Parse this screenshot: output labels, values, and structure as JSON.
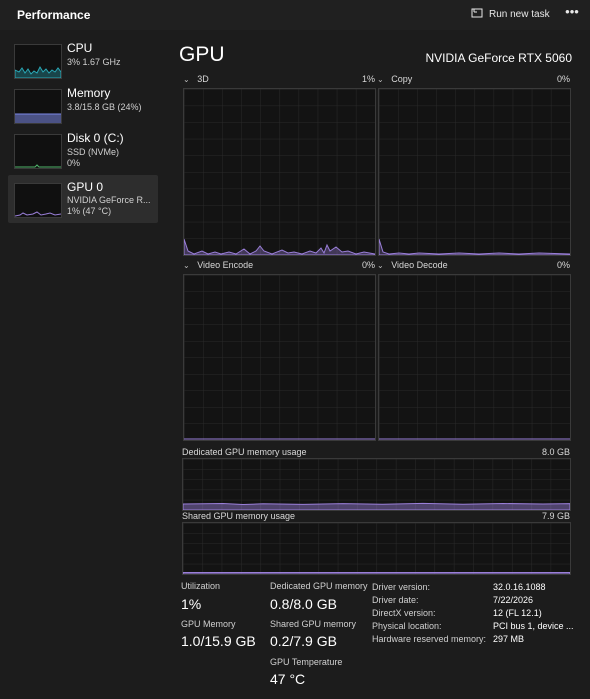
{
  "header": {
    "title": "Performance",
    "run_task_label": "Run new task",
    "more_label": "•••"
  },
  "sidebar": {
    "items": [
      {
        "name": "CPU",
        "sub1": "3%  1.67 GHz",
        "sub2": ""
      },
      {
        "name": "Memory",
        "sub1": "3.8/15.8 GB (24%)",
        "sub2": ""
      },
      {
        "name": "Disk 0 (C:)",
        "sub1": "SSD (NVMe)",
        "sub2": "0%"
      },
      {
        "name": "GPU 0",
        "sub1": "NVIDIA GeForce R...",
        "sub2": "1%  (47 °C)"
      }
    ]
  },
  "main": {
    "title": "GPU",
    "model": "NVIDIA GeForce RTX 5060",
    "graphs": {
      "g3d": {
        "label": "3D",
        "value": "1%"
      },
      "copy": {
        "label": "Copy",
        "value": "0%"
      },
      "venc": {
        "label": "Video Encode",
        "value": "0%"
      },
      "vdec": {
        "label": "Video Decode",
        "value": "0%"
      }
    },
    "dedicated": {
      "label": "Dedicated GPU memory usage",
      "value": "8.0 GB"
    },
    "shared": {
      "label": "Shared GPU memory usage",
      "value": "7.9 GB"
    }
  },
  "stats": {
    "utilization_label": "Utilization",
    "utilization": "1%",
    "gpu_memory_label": "GPU Memory",
    "gpu_memory": "1.0/15.9 GB",
    "dedicated_label": "Dedicated GPU memory",
    "dedicated": "0.8/8.0 GB",
    "shared_label": "Shared GPU memory",
    "shared": "0.2/7.9 GB",
    "temperature_label": "GPU Temperature",
    "temperature": "47 °C"
  },
  "info": {
    "driver_version_label": "Driver version:",
    "driver_version": "32.0.16.1088",
    "driver_date_label": "Driver date:",
    "driver_date": "7/22/2026",
    "directx_label": "DirectX version:",
    "directx": "12 (FL 12.1)",
    "physical_label": "Physical location:",
    "physical": "PCI bus 1, device ...",
    "reserved_label": "Hardware reserved memory:",
    "reserved": "297 MB"
  },
  "colors": {
    "accent_cpu": "#2aa8b6",
    "accent_memory": "#7b88e6",
    "accent_gpu": "#9a7fd9"
  }
}
